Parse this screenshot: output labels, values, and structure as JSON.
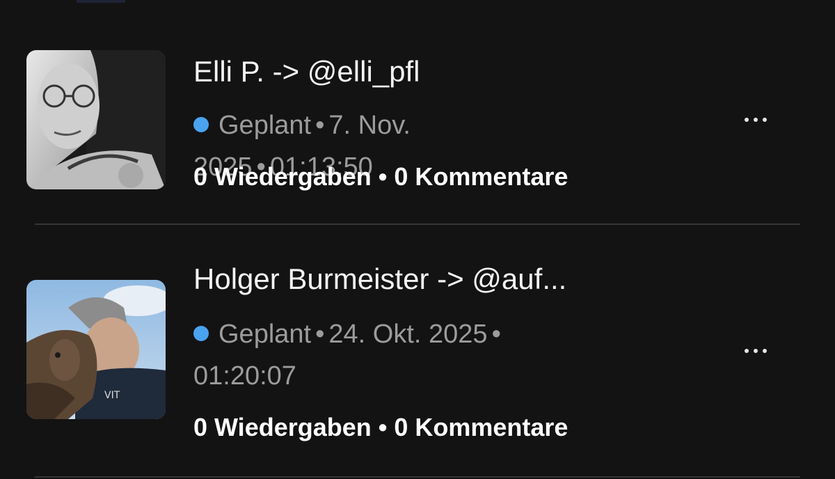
{
  "posts": [
    {
      "title": "Elli P. -> @elli_pfl",
      "status": "Geplant",
      "date": "7. Nov. 2025",
      "time": "01:13:50",
      "stats": "0 Wiedergaben • 0 Kommentare",
      "thumbnail": "woman-with-glasses-photo",
      "more_icon": "more-horizontal-icon"
    },
    {
      "title": "Holger Burmeister -> @auf...",
      "status": "Geplant",
      "date": "24. Okt. 2025",
      "time": "01:20:07",
      "stats": "0 Wiedergaben • 0 Kommentare",
      "thumbnail": "man-with-dog-photo",
      "more_icon": "more-horizontal-icon"
    }
  ],
  "separator": "•",
  "colors": {
    "background": "#131314",
    "status_dot": "#4aa3f0",
    "meta_text": "#9c9c9c",
    "divider": "#353537"
  }
}
